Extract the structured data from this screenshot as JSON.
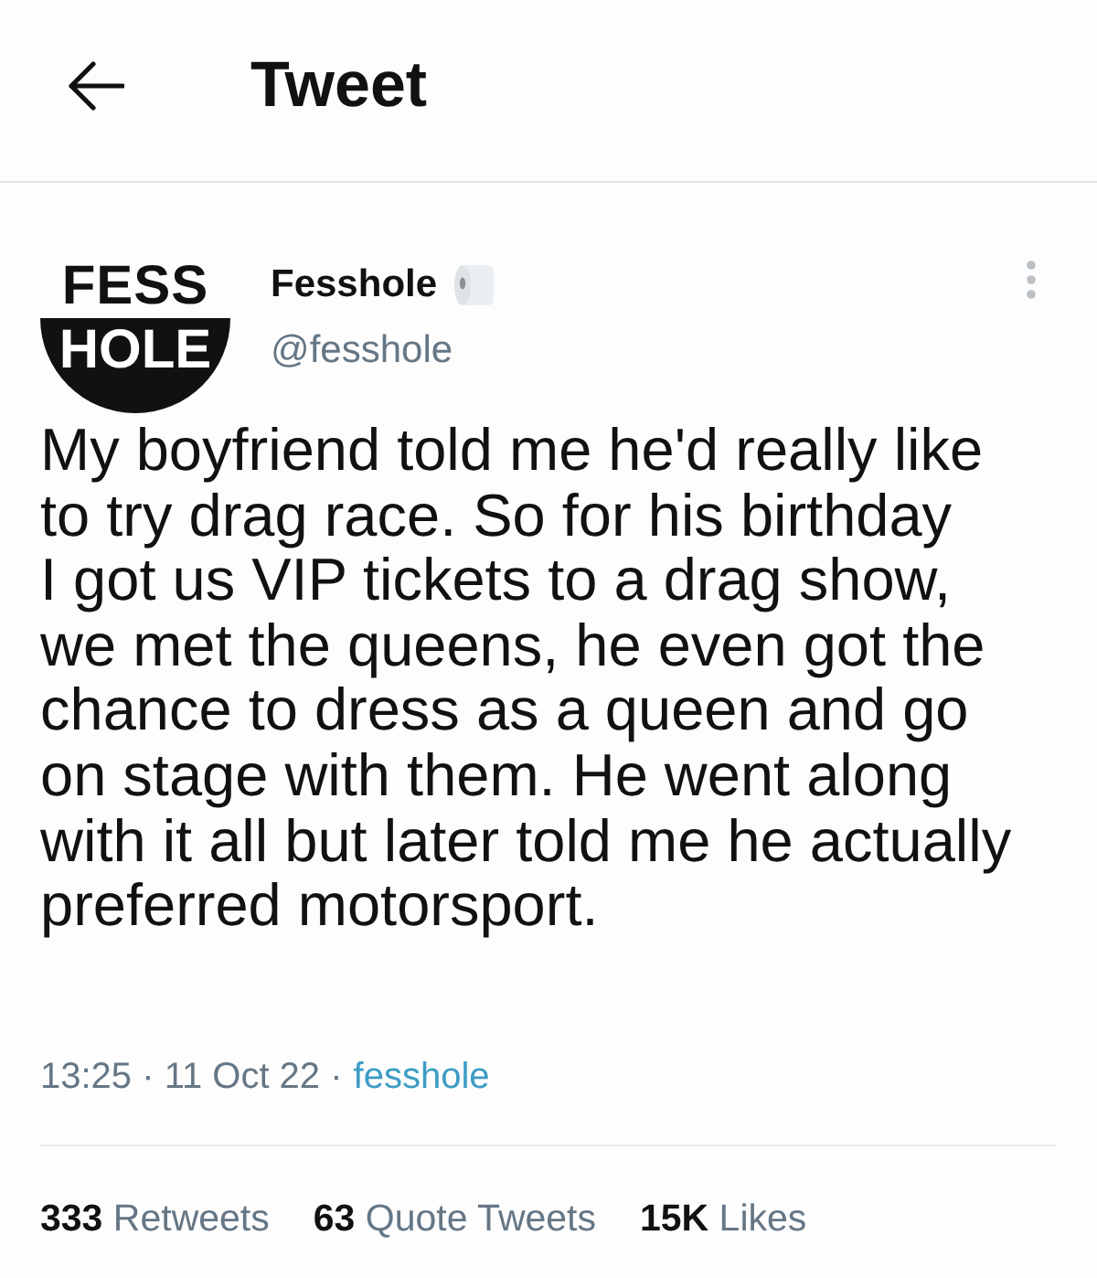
{
  "header": {
    "title": "Tweet"
  },
  "tweet": {
    "logo": {
      "top": "FESS",
      "bottom": "HOLE"
    },
    "author": {
      "name": "Fesshole",
      "handle": "@fesshole"
    },
    "text": "My boyfriend told me he'd really like\nto try drag race. So for his birthday\nI got us VIP tickets to a drag show,\nwe met the queens, he even got the\nchance to dress as a queen and go\non stage with them. He went along\nwith it all but later told me he actually\npreferred motorsport.",
    "timestamp": "13:25 · 11 Oct 22 ·",
    "source": "fesshole",
    "stats": [
      {
        "count": "333",
        "label": "Retweets"
      },
      {
        "count": "63",
        "label": "Quote Tweets"
      },
      {
        "count": "15K",
        "label": "Likes"
      }
    ]
  }
}
